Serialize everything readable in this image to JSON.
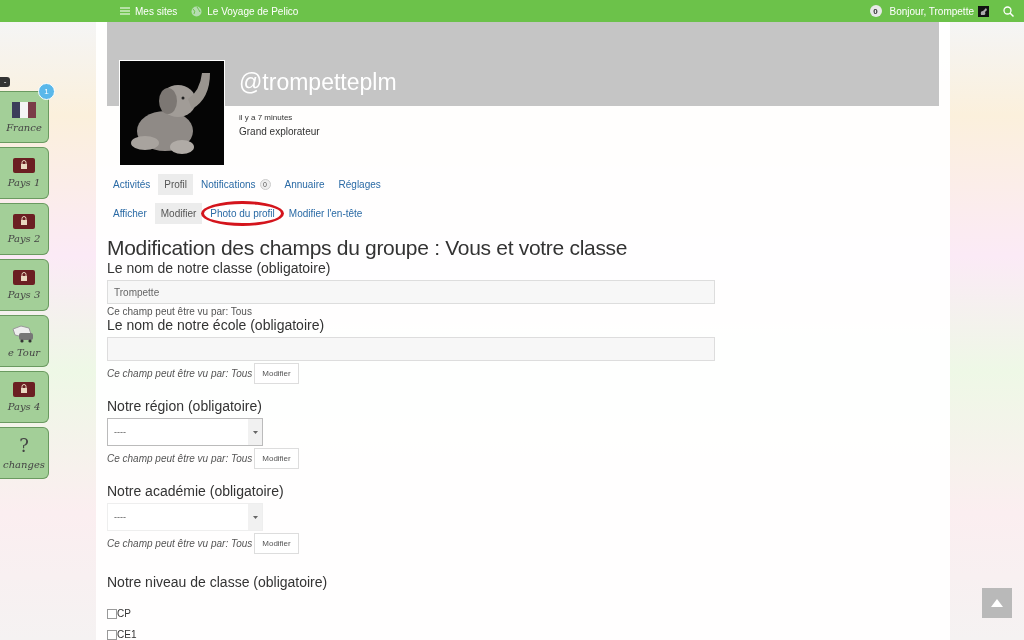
{
  "topbar": {
    "menu_label": "Mes sites",
    "site": "Le Voyage de Pelico",
    "notifications": "0",
    "greeting": "Bonjour, Trompette"
  },
  "sidebar": {
    "collapse": "-",
    "items": [
      {
        "kind": "flag",
        "label": "France",
        "badge": "1"
      },
      {
        "kind": "locked",
        "label": "Pays 1"
      },
      {
        "kind": "locked",
        "label": "Pays 2"
      },
      {
        "kind": "locked",
        "label": "Pays 3"
      },
      {
        "kind": "tour",
        "label": "e Tour"
      },
      {
        "kind": "locked",
        "label": "Pays 4"
      },
      {
        "kind": "question",
        "label": "changes",
        "glyph": "?"
      }
    ]
  },
  "profile": {
    "handle": "@trompetteplm",
    "last_active": "il y a 7 minutes",
    "rank": "Grand explorateur"
  },
  "tabs": [
    {
      "label": "Activités",
      "selected": false
    },
    {
      "label": "Profil",
      "selected": true
    },
    {
      "label": "Notifications",
      "selected": false,
      "count": "0"
    },
    {
      "label": "Annuaire",
      "selected": false
    },
    {
      "label": "Réglages",
      "selected": false
    }
  ],
  "subtabs": [
    {
      "label": "Afficher",
      "selected": false,
      "highlighted": false
    },
    {
      "label": "Modifier",
      "selected": true,
      "highlighted": false
    },
    {
      "label": "Photo du profil",
      "selected": false,
      "highlighted": true
    },
    {
      "label": "Modifier l'en-tête",
      "selected": false,
      "highlighted": false
    }
  ],
  "form": {
    "title": "Modification des champs du groupe : Vous et votre classe",
    "fields": [
      {
        "kind": "text",
        "label": "Le nom de notre classe (obligatoire)",
        "value": "Trompette",
        "visibility": "Ce champ peut être vu par: Tous",
        "italic": false
      },
      {
        "kind": "text",
        "label": "Le nom de notre école (obligatoire)",
        "visibility": "Ce champ peut être vu par: Tous",
        "italic": true,
        "button": "Modifier"
      },
      {
        "kind": "select",
        "label": "Notre région (obligatoire)",
        "value": "----",
        "visibility": "Ce champ peut être vu par: Tous",
        "italic": true,
        "button": "Modifier"
      },
      {
        "kind": "select",
        "label": "Notre académie (obligatoire)",
        "value": "----",
        "visibility": "Ce champ peut être vu par: Tous",
        "italic": true,
        "button": "Modifier"
      },
      {
        "kind": "checkboxes",
        "label": "Notre niveau de classe (obligatoire)",
        "options": [
          {
            "label": "CP",
            "checked": false
          },
          {
            "label": "CE1",
            "checked": false
          }
        ]
      }
    ]
  }
}
